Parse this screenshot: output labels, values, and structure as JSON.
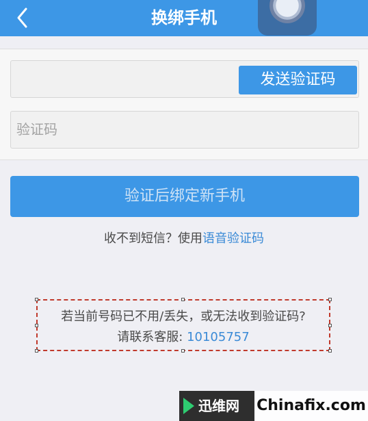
{
  "header": {
    "title": "换绑手机",
    "back_icon": "chevron-left-icon",
    "overlay_icon": "assistive-touch-icon"
  },
  "form": {
    "phone_value": "",
    "send_code_label": "发送验证码",
    "code_placeholder": "验证码"
  },
  "submit": {
    "label": "验证后绑定新手机"
  },
  "sms_hint": {
    "prefix": "收不到短信？使用",
    "link": "语音验证码"
  },
  "notice": {
    "line1": "若当前号码已不用/丢失，或无法收到验证码?",
    "line2_prefix": "请联系客服: ",
    "hotline": "10105757"
  },
  "watermark": {
    "left": "迅维网",
    "right": "Chinafix.com"
  },
  "colors": {
    "primary": "#3d97e6",
    "link": "#3a8ad6",
    "background": "#efeff4",
    "highlight_border": "#c0392b"
  }
}
